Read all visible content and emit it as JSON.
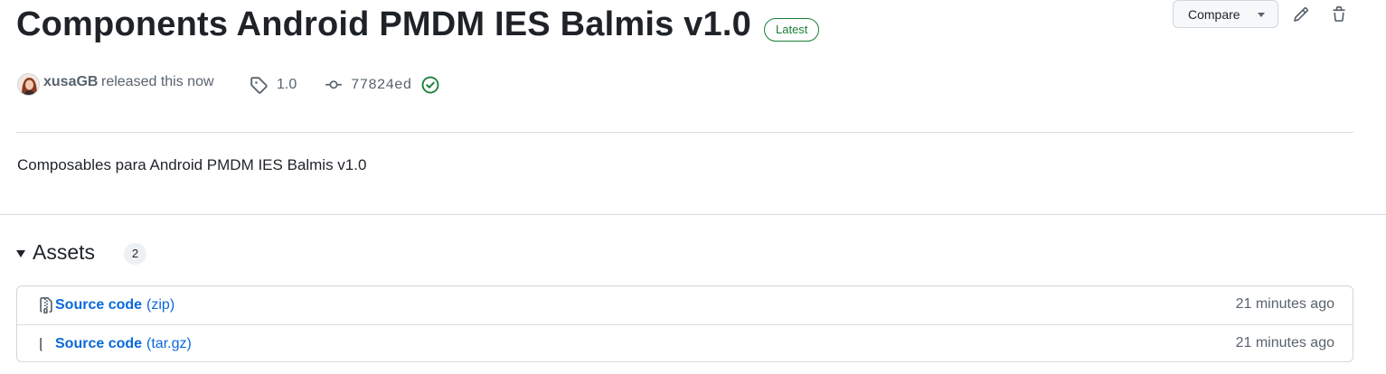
{
  "release": {
    "title": "Components Android PMDM IES Balmis v1.0",
    "badge": "Latest",
    "author": "xusaGB",
    "released_text": "released this now",
    "tag": "1.0",
    "commit": "77824ed",
    "description": "Composables para Android PMDM IES Balmis v1.0"
  },
  "header_actions": {
    "compare_label": "Compare",
    "edit_icon": "pencil-icon",
    "delete_icon": "trash-icon"
  },
  "assets": {
    "heading": "Assets",
    "count": "2",
    "items": [
      {
        "name": "Source code",
        "ext": "(zip)",
        "time": "21 minutes ago"
      },
      {
        "name": "Source code",
        "ext": "(tar.gz)",
        "time": "21 minutes ago"
      }
    ]
  },
  "colors": {
    "link": "#0969da",
    "success": "#1a7f37",
    "muted": "#59636e",
    "border": "#d0d7de"
  }
}
